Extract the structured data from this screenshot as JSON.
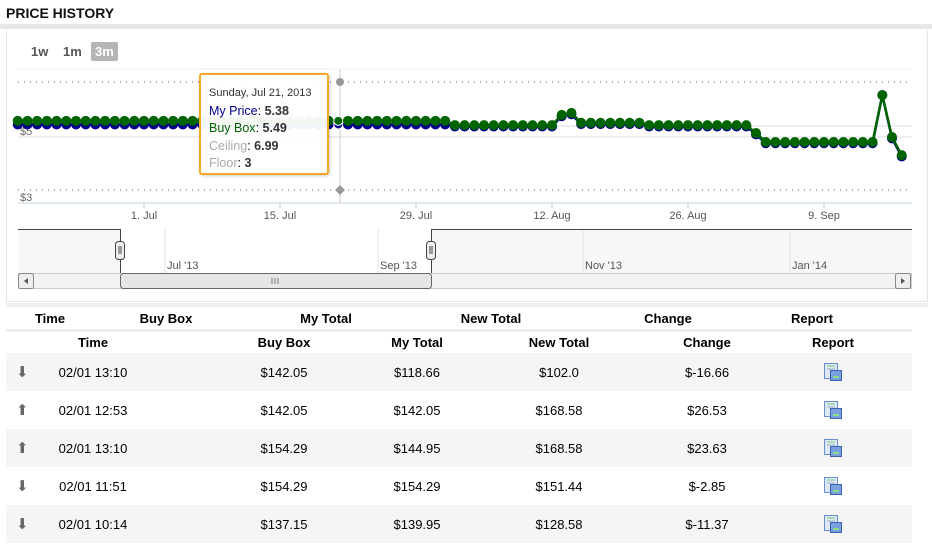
{
  "title": "PRICE HISTORY",
  "range_buttons": [
    {
      "label": "1w",
      "selected": false
    },
    {
      "label": "1m",
      "selected": false
    },
    {
      "label": "3m",
      "selected": true
    }
  ],
  "tooltip": {
    "date": "Sunday, Jul 21, 2013",
    "my_price_label": "My Price",
    "my_price": "5.38",
    "buy_box_label": "Buy Box",
    "buy_box": "5.49",
    "ceiling_label": "Ceiling",
    "ceiling": "6.99",
    "floor_label": "Floor",
    "floor": "3"
  },
  "chart_data": {
    "type": "line",
    "y_tick_labels": [
      "$5",
      "$3"
    ],
    "x_tick_labels": [
      "1. Jul",
      "15. Jul",
      "29. Jul",
      "12. Aug",
      "26. Aug",
      "9. Sep"
    ],
    "colors": {
      "my_price": "#00008b",
      "buy_box": "#006400",
      "ceiling": "#aaaaaa",
      "floor": "#aaaaaa",
      "tooltip_border": "#f5a623"
    },
    "x": [
      "2013-06-18",
      "2013-06-19",
      "2013-06-20",
      "2013-06-21",
      "2013-06-22",
      "2013-06-23",
      "2013-06-24",
      "2013-06-25",
      "2013-06-26",
      "2013-06-27",
      "2013-06-28",
      "2013-06-29",
      "2013-06-30",
      "2013-07-01",
      "2013-07-02",
      "2013-07-03",
      "2013-07-04",
      "2013-07-05",
      "2013-07-06",
      "2013-07-07",
      "2013-07-08",
      "2013-07-09",
      "2013-07-10",
      "2013-07-11",
      "2013-07-12",
      "2013-07-13",
      "2013-07-14",
      "2013-07-15",
      "2013-07-16",
      "2013-07-17",
      "2013-07-18",
      "2013-07-19",
      "2013-07-20",
      "2013-07-21",
      "2013-07-22",
      "2013-07-23",
      "2013-07-24",
      "2013-07-25",
      "2013-07-26",
      "2013-07-27",
      "2013-07-28",
      "2013-07-29",
      "2013-07-30",
      "2013-07-31",
      "2013-08-01",
      "2013-08-02",
      "2013-08-03",
      "2013-08-04",
      "2013-08-05",
      "2013-08-06",
      "2013-08-07",
      "2013-08-08",
      "2013-08-09",
      "2013-08-10",
      "2013-08-11",
      "2013-08-12",
      "2013-08-13",
      "2013-08-14",
      "2013-08-15",
      "2013-08-16",
      "2013-08-17",
      "2013-08-18",
      "2013-08-19",
      "2013-08-20",
      "2013-08-21",
      "2013-08-22",
      "2013-08-23",
      "2013-08-24",
      "2013-08-25",
      "2013-08-26",
      "2013-08-27",
      "2013-08-28",
      "2013-08-29",
      "2013-08-30",
      "2013-08-31",
      "2013-09-01",
      "2013-09-02",
      "2013-09-03",
      "2013-09-04",
      "2013-09-05",
      "2013-09-06",
      "2013-09-07",
      "2013-09-08",
      "2013-09-09",
      "2013-09-10",
      "2013-09-11",
      "2013-09-12",
      "2013-09-13",
      "2013-09-14",
      "2013-09-15",
      "2013-09-16",
      "2013-09-17"
    ],
    "series": [
      {
        "name": "My Price",
        "values": [
          5.38,
          5.38,
          5.38,
          5.38,
          5.38,
          5.38,
          5.38,
          5.38,
          5.38,
          5.38,
          5.38,
          5.38,
          5.38,
          5.38,
          5.38,
          5.38,
          5.38,
          5.38,
          5.38,
          5.38,
          5.38,
          5.38,
          5.38,
          5.38,
          5.38,
          5.38,
          5.38,
          5.38,
          5.38,
          5.38,
          5.38,
          5.38,
          5.38,
          5.38,
          5.38,
          5.38,
          5.38,
          5.38,
          5.38,
          5.38,
          5.38,
          5.38,
          5.38,
          5.38,
          5.38,
          5.32,
          5.32,
          5.32,
          5.32,
          5.32,
          5.32,
          5.32,
          5.32,
          5.32,
          5.32,
          5.32,
          5.63,
          5.69,
          5.39,
          5.39,
          5.39,
          5.39,
          5.39,
          5.39,
          5.39,
          5.32,
          5.32,
          5.32,
          5.32,
          5.32,
          5.32,
          5.32,
          5.32,
          5.32,
          5.32,
          5.32,
          5.08,
          4.81,
          4.81,
          4.81,
          4.81,
          4.81,
          4.81,
          4.81,
          4.81,
          4.81,
          4.81,
          4.81,
          4.81,
          6.27,
          4.96,
          4.41
        ]
      },
      {
        "name": "Buy Box",
        "values": [
          5.49,
          5.49,
          5.49,
          5.49,
          5.49,
          5.49,
          5.49,
          5.49,
          5.49,
          5.49,
          5.49,
          5.49,
          5.49,
          5.49,
          5.49,
          5.49,
          5.49,
          5.49,
          5.49,
          5.49,
          5.49,
          5.49,
          5.49,
          5.49,
          5.49,
          5.49,
          5.49,
          5.49,
          5.49,
          5.49,
          5.49,
          5.49,
          5.49,
          5.49,
          5.49,
          5.49,
          5.49,
          5.49,
          5.49,
          5.49,
          5.49,
          5.49,
          5.49,
          5.49,
          5.49,
          5.36,
          5.36,
          5.36,
          5.36,
          5.36,
          5.36,
          5.36,
          5.36,
          5.36,
          5.36,
          5.36,
          5.67,
          5.73,
          5.43,
          5.43,
          5.43,
          5.43,
          5.43,
          5.43,
          5.43,
          5.36,
          5.36,
          5.36,
          5.36,
          5.36,
          5.36,
          5.36,
          5.36,
          5.36,
          5.36,
          5.36,
          5.12,
          4.85,
          4.85,
          4.85,
          4.85,
          4.85,
          4.85,
          4.85,
          4.85,
          4.85,
          4.85,
          4.85,
          4.85,
          6.27,
          5.0,
          4.45
        ]
      }
    ],
    "highlighted": "2013-07-21",
    "ceiling": 6.99,
    "floor": 3
  },
  "navigator": {
    "labels": [
      "Jul '13",
      "Sep '13",
      "Nov '13",
      "Jan '14"
    ]
  },
  "outer_table": {
    "headers": [
      "Time",
      "Buy Box",
      "My Total",
      "New Total",
      "Change",
      "Report"
    ]
  },
  "table": {
    "headers": [
      "Time",
      "Buy Box",
      "My Total",
      "New Total",
      "Change",
      "Report"
    ],
    "rows": [
      {
        "direction": "down",
        "time": "02/01 13:10",
        "buy_box": "$142.05",
        "my_total": "$118.66",
        "new_total": "$102.0",
        "change": "$-16.66"
      },
      {
        "direction": "up",
        "time": "02/01 12:53",
        "buy_box": "$142.05",
        "my_total": "$142.05",
        "new_total": "$168.58",
        "change": "$26.53"
      },
      {
        "direction": "up",
        "time": "02/01 13:10",
        "buy_box": "$154.29",
        "my_total": "$144.95",
        "new_total": "$168.58",
        "change": "$23.63"
      },
      {
        "direction": "down",
        "time": "02/01 11:51",
        "buy_box": "$154.29",
        "my_total": "$154.29",
        "new_total": "$151.44",
        "change": "$-2.85"
      },
      {
        "direction": "down",
        "time": "02/01 10:14",
        "buy_box": "$137.15",
        "my_total": "$139.95",
        "new_total": "$128.58",
        "change": "$-11.37"
      }
    ]
  }
}
